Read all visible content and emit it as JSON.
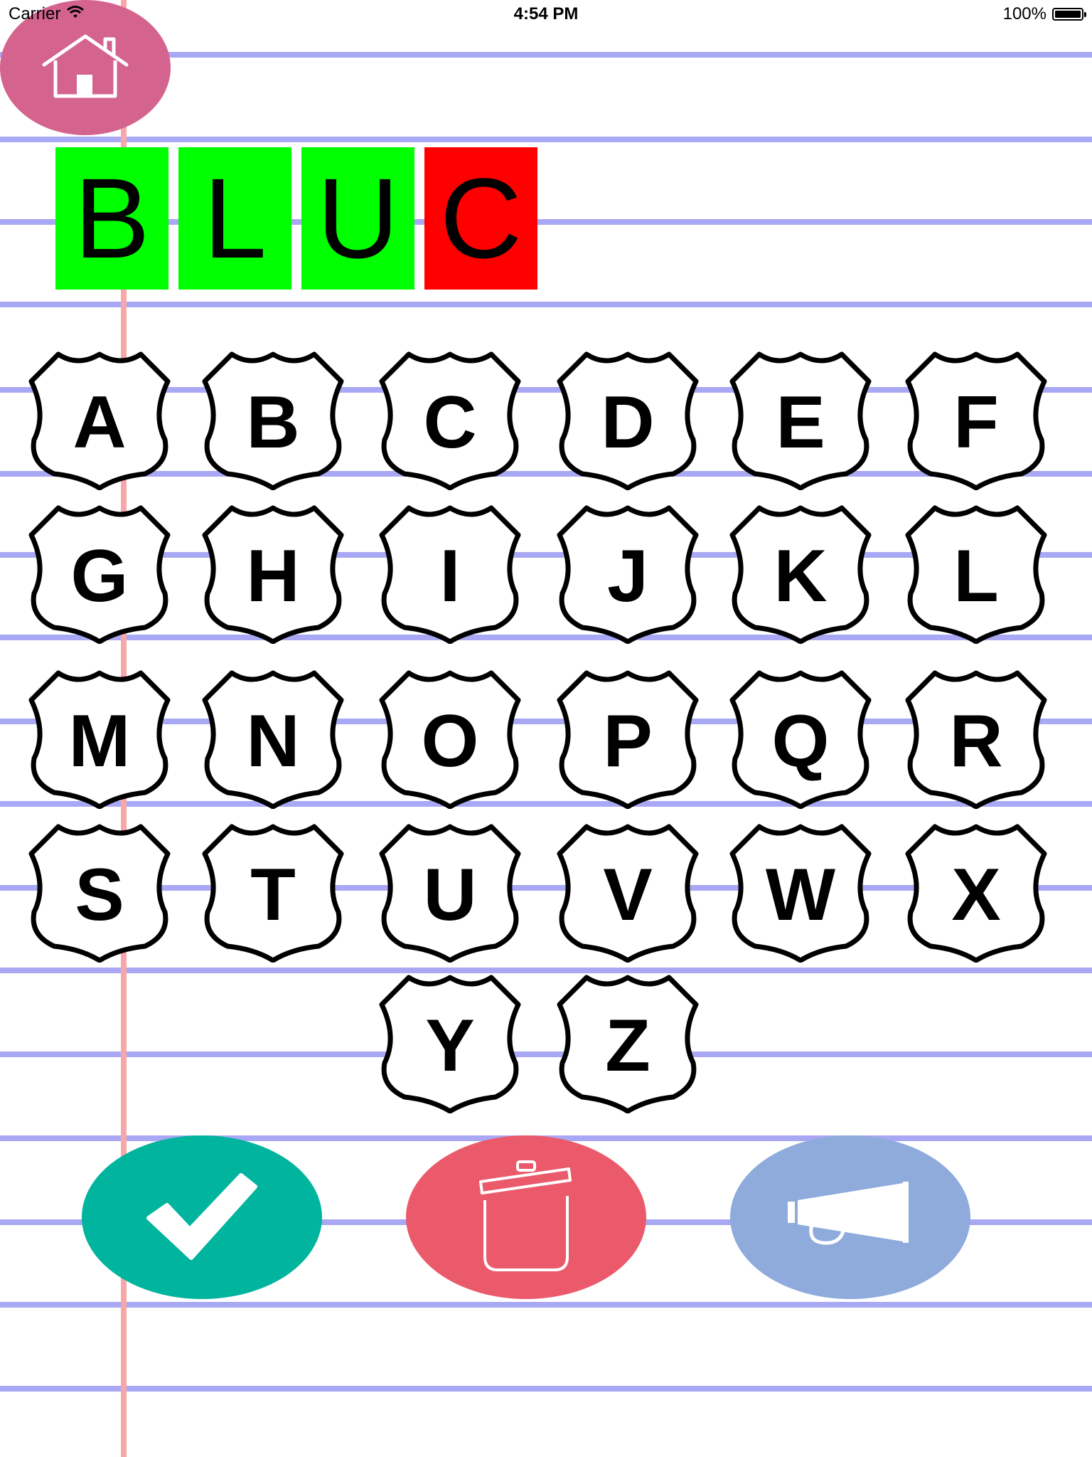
{
  "status_bar": {
    "carrier": "Carrier",
    "time": "4:54 PM",
    "battery": "100%"
  },
  "home_button": {
    "icon": "home-icon",
    "color": "#d4638e"
  },
  "word": {
    "tiles": [
      {
        "letter": "B",
        "status": "correct",
        "color": "#00ff00"
      },
      {
        "letter": "L",
        "status": "correct",
        "color": "#00ff00"
      },
      {
        "letter": "U",
        "status": "correct",
        "color": "#00ff00"
      },
      {
        "letter": "C",
        "status": "incorrect",
        "color": "#ff0000"
      }
    ]
  },
  "keyboard": {
    "rows": [
      [
        "A",
        "B",
        "C",
        "D",
        "E",
        "F"
      ],
      [
        "G",
        "H",
        "I",
        "J",
        "K",
        "L"
      ],
      [
        "M",
        "N",
        "O",
        "P",
        "Q",
        "R"
      ],
      [
        "S",
        "T",
        "U",
        "V",
        "W",
        "X"
      ],
      [
        "Y",
        "Z"
      ]
    ],
    "key_shape": "shield"
  },
  "actions": {
    "check": {
      "icon": "checkmark-icon",
      "color": "#00b49e"
    },
    "clear": {
      "icon": "trash-icon",
      "color": "#eb5a6b"
    },
    "speak": {
      "icon": "megaphone-icon",
      "color": "#8eabdc"
    }
  },
  "theme": {
    "ruled_line_color": "#a8a8f4",
    "margin_line_color": "#f7a7aa"
  }
}
